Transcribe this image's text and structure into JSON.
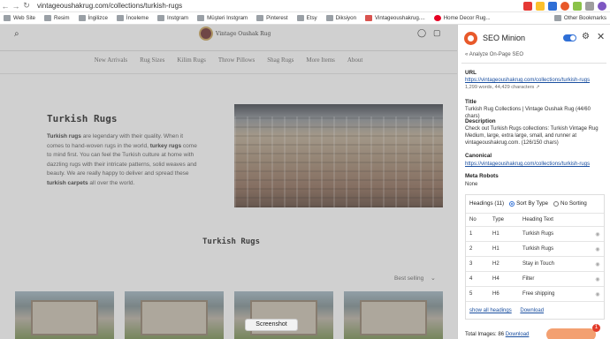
{
  "browser": {
    "url": "vintageoushakrug.com/collections/turkish-rugs",
    "back_icon": "arrow-left-icon",
    "forward_icon": "arrow-right-icon",
    "reload_icon": "reload-icon"
  },
  "bookmarks": {
    "items": [
      "Web Site",
      "Resim",
      "İngilizce",
      "İnceleme",
      "Instgram",
      "Müşteri Instgram",
      "Pinterest",
      "Etsy",
      "Diksiyon",
      "Vintageoushakrug....",
      "Home Decor Rug..."
    ],
    "other": "Other Bookmarks"
  },
  "site": {
    "logo_text": "Vintage Oushak Rug",
    "menu": [
      "New Arrivals",
      "Rug Sizes",
      "Kilim Rugs",
      "Throw Pillows",
      "Shag Rugs",
      "More Items",
      "About"
    ],
    "hero_title": "Turkish Rugs",
    "hero_text_1": "Turkish rugs",
    "hero_text_2": " are legendary with their quality. When it comes to hand-woven rugs in the world, ",
    "hero_text_3": "turkey rugs",
    "hero_text_4": " come to mind first. You can feel the Turkish culture at home with dazzling rugs with their intricate patterns, solid weaves and beauty. We are really happy to deliver and spread these ",
    "hero_text_5": "turkish carpets",
    "hero_text_6": " all over the world.",
    "section_title": "Turkish Rugs",
    "sort_label": "Best selling",
    "screenshot_label": "Screenshot"
  },
  "seo": {
    "title": "SEO Minion",
    "back_label": "Analyze On-Page SEO",
    "url_label": "URL",
    "url_value": "https://vintageoushakrug.com/collections/turkish-rugs",
    "url_meta": "1,299 words, 44,429 characters",
    "title_label": "Title",
    "title_value": "Turkish Rug Collections | Vintage Oushak Rug (44/60 chars)",
    "desc_label": "Description",
    "desc_value": "Check out Turkish Rugs collections: Turkish Vintage Rug Medium, large, extra large, small, and runner at vintageoushakrug.com. (126/150 chars)",
    "canonical_label": "Canonical",
    "canonical_value": "https://vintageoushakrug.com/collections/turkish-rugs",
    "robots_label": "Meta Robots",
    "robots_value": "None",
    "headings_label": "Headings (11)",
    "sort_type_label": "Sort By Type",
    "no_sort_label": "No Sorting",
    "columns": [
      "No",
      "Type",
      "Heading Text"
    ],
    "rows": [
      {
        "no": "1",
        "type": "H1",
        "text": "Turkish Rugs"
      },
      {
        "no": "2",
        "type": "H1",
        "text": "Turkish Rugs"
      },
      {
        "no": "3",
        "type": "H2",
        "text": "Stay in Touch"
      },
      {
        "no": "4",
        "type": "H4",
        "text": "Filter"
      },
      {
        "no": "5",
        "type": "H6",
        "text": "Free shipping"
      }
    ],
    "show_all": "show all headings",
    "download": "Download",
    "total_images": "Total Images: 86",
    "total_download": "Download",
    "notification_count": "1"
  }
}
